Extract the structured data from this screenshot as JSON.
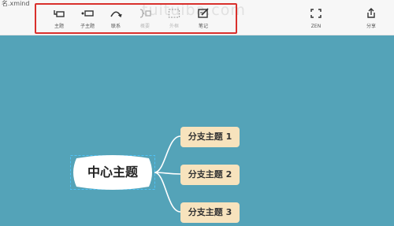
{
  "filename": "名.xmind",
  "toolbar": {
    "topic": "主题",
    "subtopic": "子主题",
    "relationship": "联系",
    "summary": "概要",
    "boundary": "外框",
    "note": "笔记",
    "zen": "ZEN",
    "share": "分享"
  },
  "watermark": "tuituiba.com",
  "map": {
    "central_topic": "中心主题",
    "branches": [
      "分支主题 1",
      "分支主题 2",
      "分支主题 3"
    ]
  },
  "colors": {
    "canvas": "#54a3b8",
    "branch_fill": "#f7e3bd",
    "highlight_box": "#d9302c",
    "selection": "#4fc3f7"
  }
}
